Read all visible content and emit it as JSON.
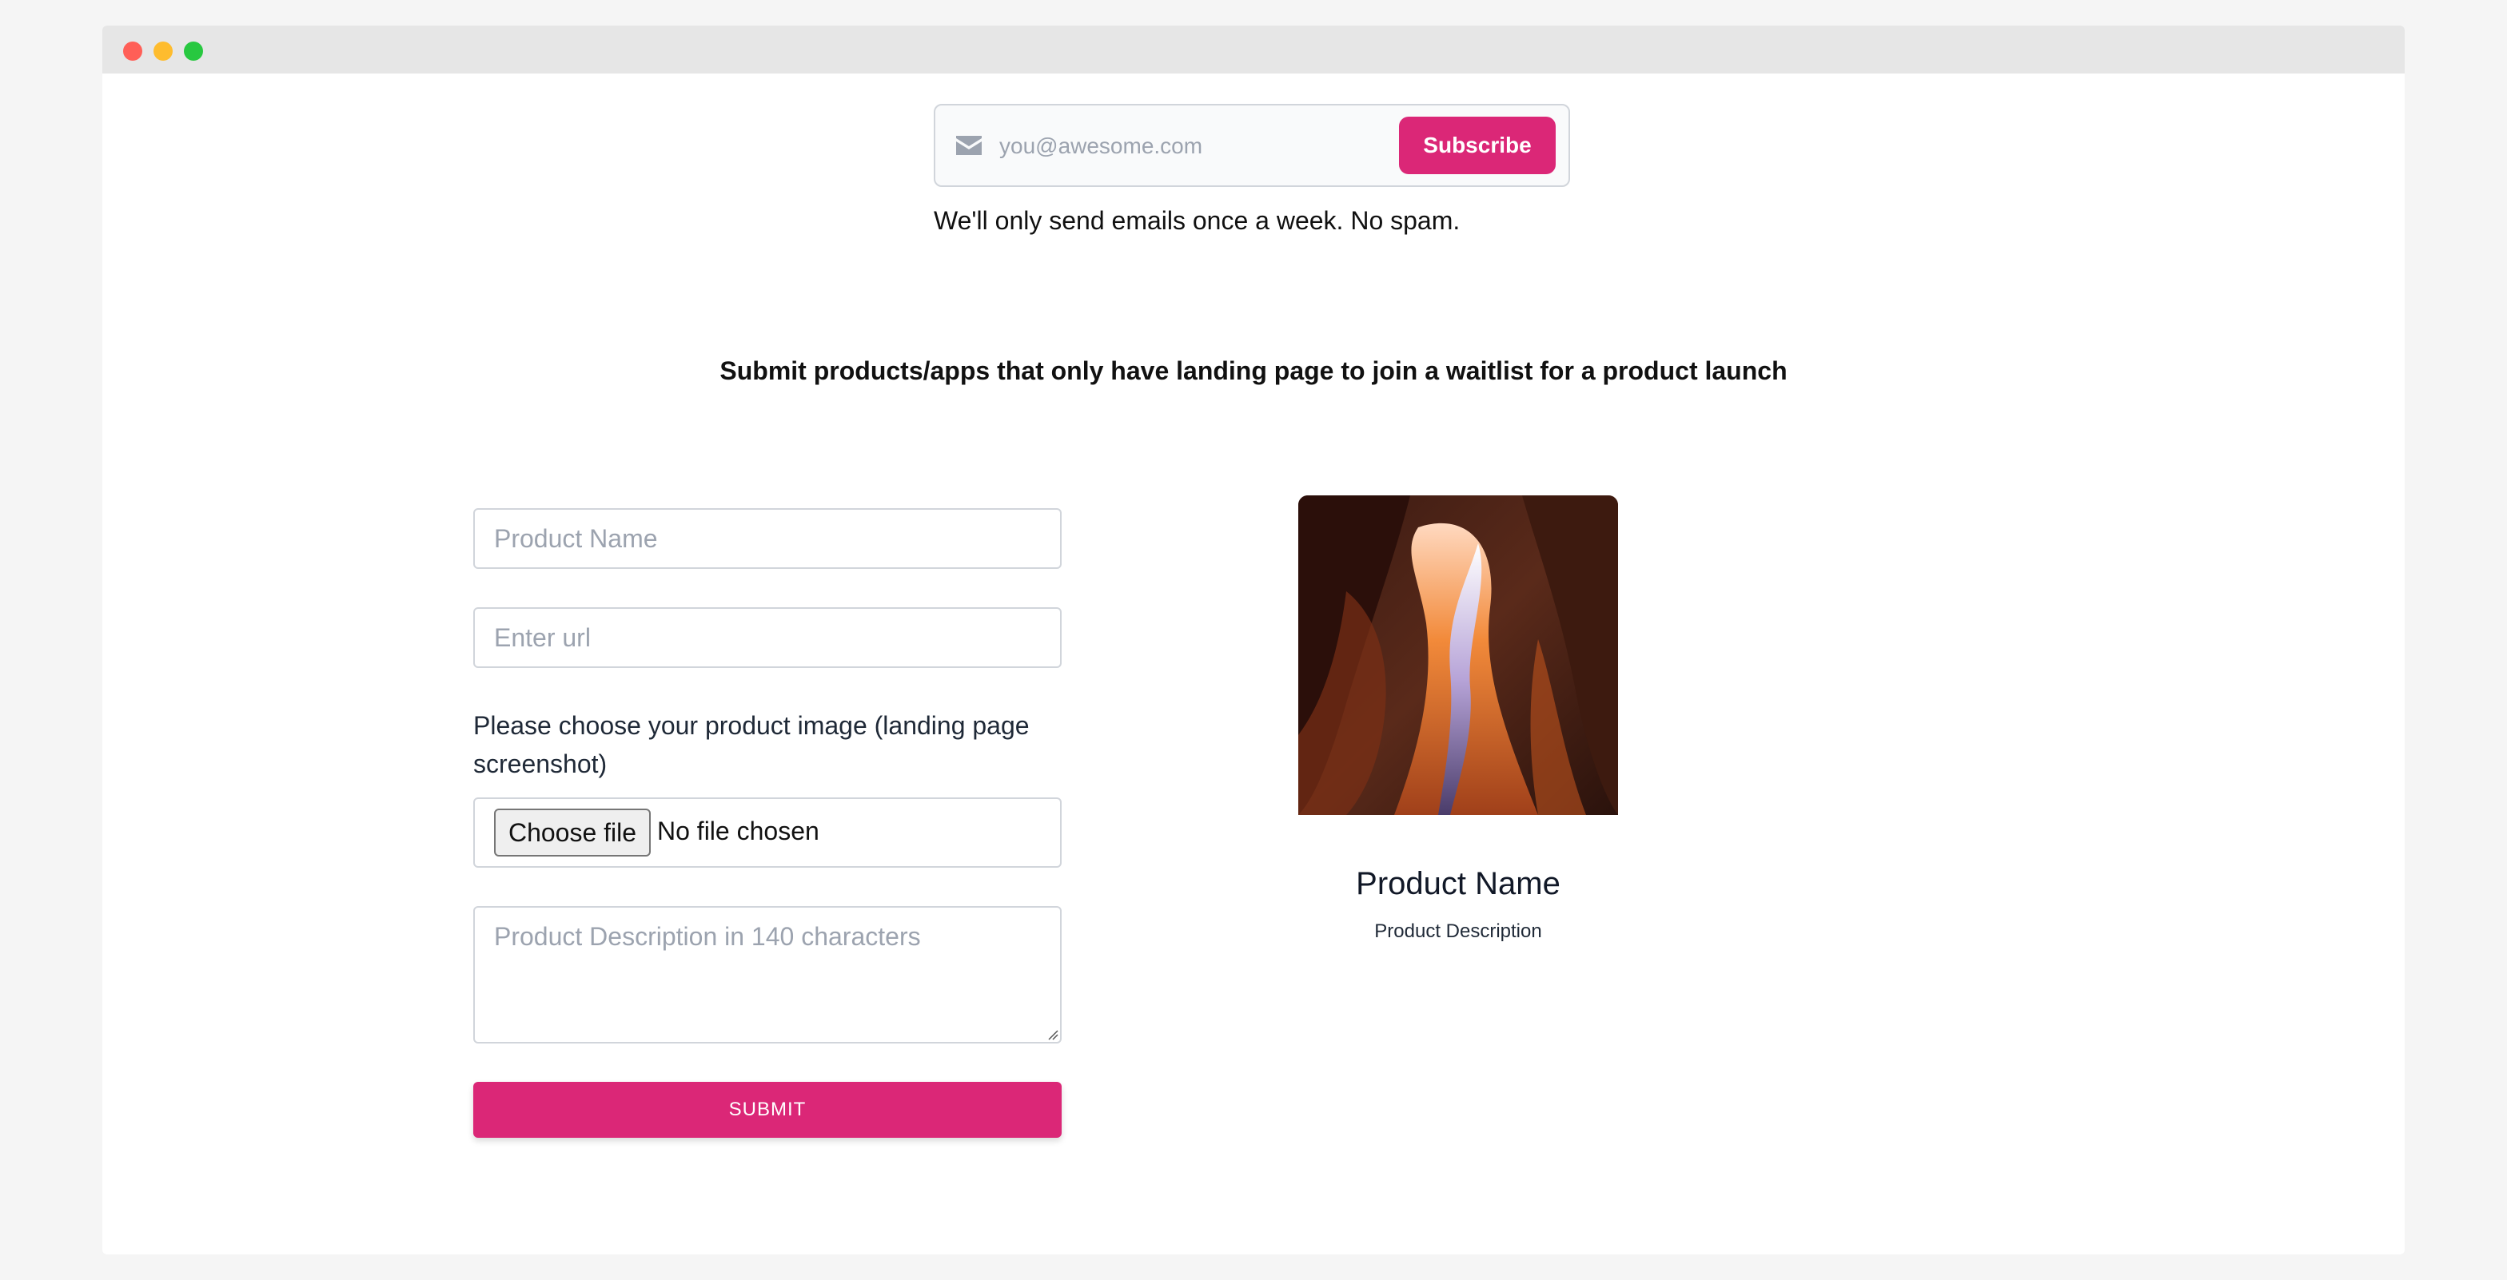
{
  "subscribe": {
    "email_placeholder": "you@awesome.com",
    "email_value": "",
    "button_label": "Subscribe",
    "note": "We'll only send emails once a week. No spam.",
    "icon": "mail-icon"
  },
  "headline": "Submit products/apps that only have landing page to join a waitlist for a product launch",
  "form": {
    "product_name_placeholder": "Product Name",
    "url_placeholder": "Enter url",
    "image_label": "Please choose your product image (landing page screenshot)",
    "choose_file_label": "Choose file",
    "file_status": "No file chosen",
    "description_placeholder": "Product Description in 140 characters",
    "submit_label": "SUBMIT"
  },
  "preview": {
    "title": "Product Name",
    "description": "Product Description",
    "image": "canyon-photo"
  },
  "colors": {
    "accent": "#db2777",
    "window_chrome": "#e6e6e6",
    "border": "#d1d5db"
  }
}
